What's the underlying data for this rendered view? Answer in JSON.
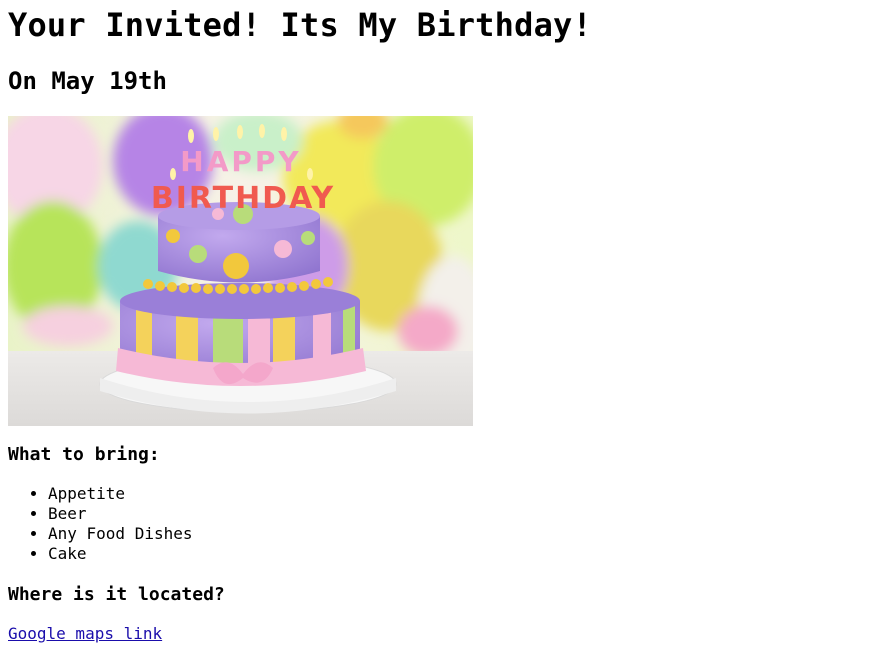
{
  "page": {
    "title": "Your Invited! Its My Birthday!",
    "subtitle": "On May 19th"
  },
  "image": {
    "cake_topper_top": "HAPPY",
    "cake_topper_bottom": "BIRTHDAY"
  },
  "bring": {
    "heading": "What to bring:",
    "items": [
      "Appetite",
      "Beer",
      "Any Food Dishes",
      "Cake"
    ]
  },
  "location": {
    "heading": "Where is it located?",
    "link_text": "Google maps link"
  },
  "colors": {
    "link": "#1a0dab",
    "frosting_purple": "#a58bdc",
    "ribbon_pink": "#f6b9d6"
  }
}
